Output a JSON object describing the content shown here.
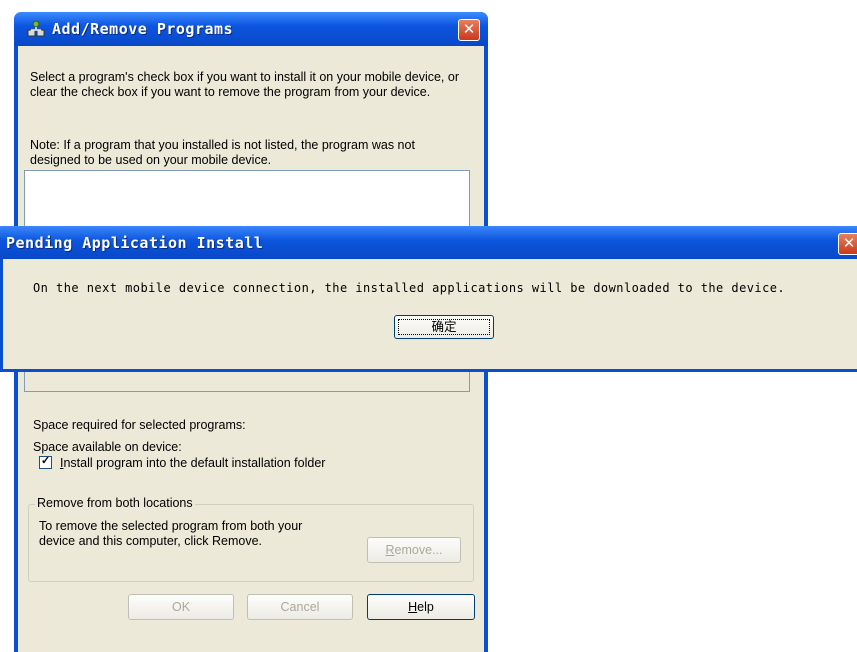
{
  "add_remove": {
    "title": "Add/Remove Programs",
    "close_glyph": "✕",
    "instructions": "Select a program's check box if you want to install it on your mobile device, or clear the check box if you want to remove the program from your device.",
    "note": "Note:  If a program that you installed is not listed, the program was not designed to be used on your mobile device.",
    "space_required_label": "Space required for selected programs:",
    "space_available_label": "Space available on device:",
    "install_default_checkbox": {
      "label_hotkey": "I",
      "label_rest": "nstall program into the default installation folder",
      "checked": true
    },
    "remove_group": {
      "legend": "Remove from both locations",
      "description": "To remove the selected program from both your device and this computer, click Remove.",
      "remove_hotkey": "R",
      "remove_rest": "emove..."
    },
    "buttons": {
      "ok": "OK",
      "cancel": "Cancel",
      "help_hotkey": "H",
      "help_rest": "elp"
    },
    "icon": "add-remove-programs-icon"
  },
  "pending": {
    "title": "Pending Application Install",
    "close_glyph": "✕",
    "message": "On the next mobile device connection, the installed applications will be downloaded to the device.",
    "ok_label": "确定"
  },
  "colors": {
    "titlebar_blue": "#0a4fcf",
    "dialog_face": "#ece9d8",
    "close_red": "#c9391c",
    "disabled_text": "#aca899"
  }
}
